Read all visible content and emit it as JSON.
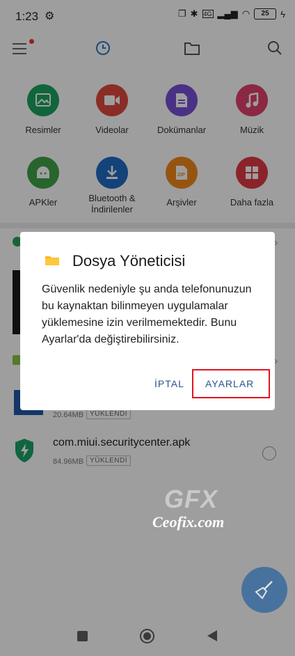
{
  "status": {
    "time": "1:23",
    "battery": "25",
    "network_label": "4G"
  },
  "categories": [
    {
      "label": "Resimler",
      "color": "#1aa35f",
      "icon": "image-icon"
    },
    {
      "label": "Videolar",
      "color": "#e04a3f",
      "icon": "video-icon"
    },
    {
      "label": "Dokümanlar",
      "color": "#7a4fd8",
      "icon": "document-icon"
    },
    {
      "label": "Müzik",
      "color": "#e0416e",
      "icon": "music-icon"
    },
    {
      "label": "APKler",
      "color": "#3fa34a",
      "icon": "android-icon"
    },
    {
      "label": "Bluetooth &\nİndirilenler",
      "color": "#1f6cc4",
      "icon": "download-icon"
    },
    {
      "label": "Arşivler",
      "color": "#f08a1c",
      "icon": "zip-icon"
    },
    {
      "label": "Daha fazla",
      "color": "#e03a45",
      "icon": "grid-icon"
    }
  ],
  "files": [
    {
      "name": "",
      "size": "20.64MB",
      "badge": "YÜKLENDİ"
    },
    {
      "name": "com.miui.securitycenter.apk",
      "size": "84.96MB",
      "badge": "YÜKLENDİ"
    }
  ],
  "dialog": {
    "title": "Dosya Yöneticisi",
    "message": "Güvenlik nedeniyle şu anda telefonunuzun bu kaynaktan bilinmeyen uygulamalar yüklemesine izin verilmemektedir. Bunu Ayarlar'da değiştirebilirsiniz.",
    "cancel_label": "İPTAL",
    "settings_label": "AYARLAR"
  },
  "watermark": {
    "logo": "GFX",
    "site": "Ceofix.com"
  },
  "colors": {
    "accent": "#2a5590",
    "highlight": "#e1141e",
    "fab": "#23609e"
  }
}
